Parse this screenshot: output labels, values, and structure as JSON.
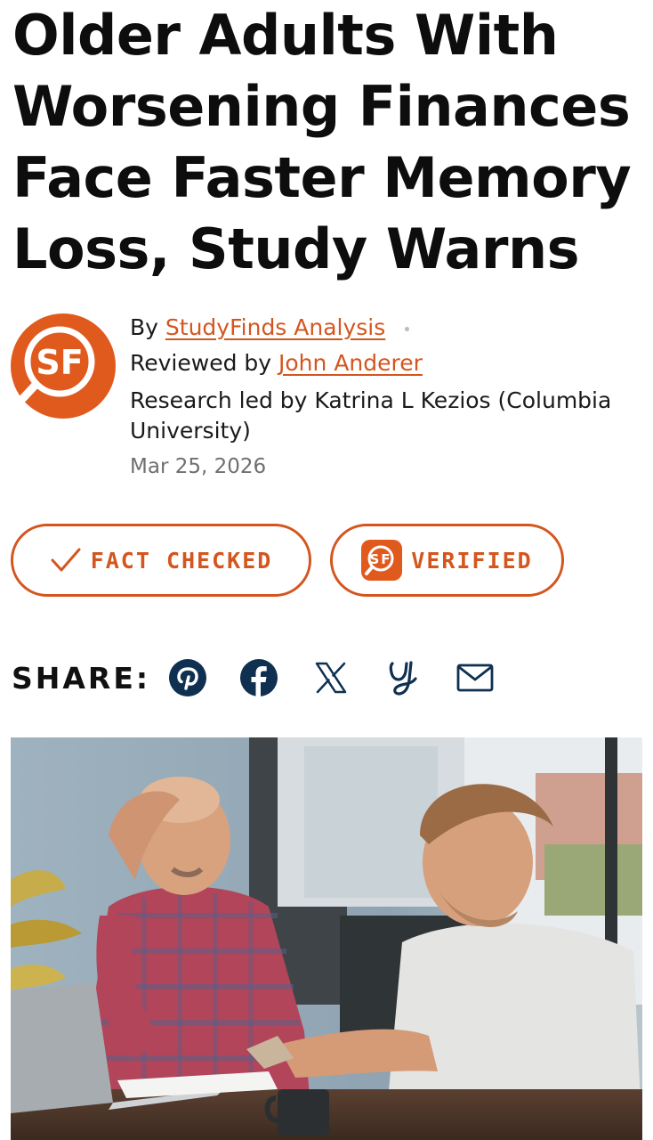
{
  "article": {
    "headline": "Older Adults With Worsening Finances Face Faster Memory Loss, Study Warns",
    "byline": {
      "by_prefix": "By",
      "author": "StudyFinds Analysis",
      "reviewed_prefix": "Reviewed by",
      "reviewer": "John Anderer",
      "research": "Research led by Katrina L Kezios (Columbia University)",
      "date": "Mar 25, 2026"
    },
    "avatar": {
      "logo_text": "SF",
      "icon": "studyfinds-logo"
    }
  },
  "badges": {
    "fact_checked": {
      "label": "FACT CHECKED",
      "icon": "check-icon"
    },
    "verified": {
      "label": "VERIFIED",
      "icon": "studyfinds-logo"
    }
  },
  "share": {
    "label": "SHARE:",
    "icons": [
      "pinterest-icon",
      "facebook-icon",
      "x-icon",
      "yahoo-icon",
      "email-icon"
    ]
  },
  "photo": {
    "icon": "article-photo"
  },
  "colors": {
    "accent": "#d4561f",
    "share_icon": "#0f3050",
    "text": "#111111"
  }
}
